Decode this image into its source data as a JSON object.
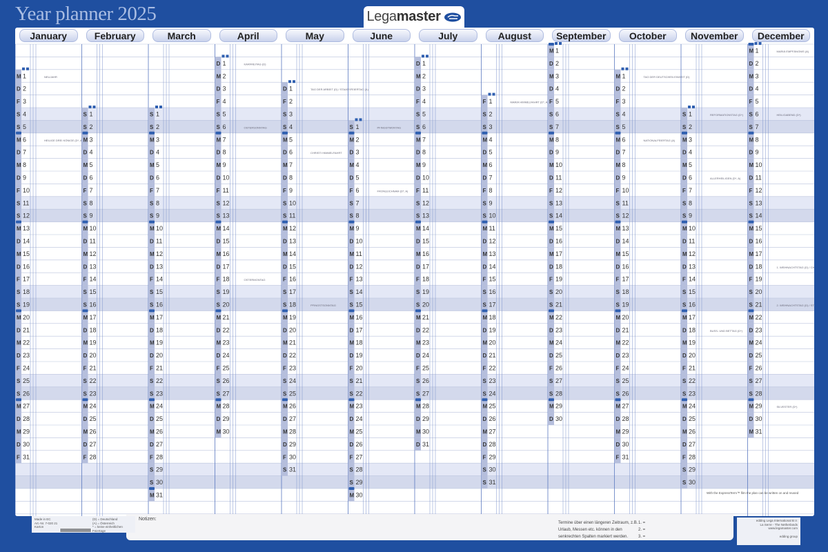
{
  "title": "Year planner 2025",
  "brand": {
    "prefix": "Lega",
    "bold": "master"
  },
  "months": [
    "January",
    "February",
    "March",
    "April",
    "May",
    "June",
    "July",
    "August",
    "September",
    "October",
    "November",
    "December"
  ],
  "weekday_letters": [
    "M",
    "D",
    "M",
    "D",
    "F",
    "S",
    "S"
  ],
  "footer": {
    "notes_label": "Notizen:",
    "termine_text": "Termine über einen längeren Zeitraum, z.B. Urlaub, Messen etc. können in den senkrechten Spalten markiert werden.",
    "numbered": [
      "1. =",
      "2. =",
      "3. ="
    ],
    "made_in": "Made in EC",
    "art_no": "Art.-Nr. 7-020 21",
    "karton": "Karton",
    "legend": [
      "(D) = Deutschland",
      "(A) = Österreich",
      "* = keine einheitlichen Feiertage"
    ],
    "company": "edding Lega International B.V.",
    "company_loc": "La Serre - The Netherlands",
    "company_web": "www.legamaster.com",
    "edding": "edding group",
    "tf_note": "With the ExpressTerm™ film the plan can be written on and reused"
  },
  "holiday_notes": [
    "NEUJAHR",
    "HEILIGE DREI KÖNIGE (D*, A)",
    "KARFREITAG (D)",
    "OSTERSONNTAG",
    "OSTERMONTAG",
    "TAG DER ARBEIT (D) / STAATSFEIERTAG (A)",
    "CHRISTI HIMMELFAHRT",
    "PFINGSTSONNTAG",
    "PFINGSTMONTAG",
    "FRONLEICHNAM (D*, A)",
    "MARIÄ HIMMELFAHRT (D*, A)",
    "TAG DER DEUTSCHEN EINHEIT (D)",
    "NATIONALFEIERTAG (A)",
    "REFORMATIONSTAG (D*)",
    "ALLERHEILIGEN (D*, A)",
    "BUSS- UND BETTAG (D*)",
    "MARIÄ EMPFÄNGNIS (A)",
    "HEILIGABEND (D*)",
    "1. WEIHNACHTSTAG (D) / CHRISTTAG (A)",
    "2. WEIHNACHTSTAG (D) / STEFANITAG (A)",
    "SILVESTER (D*)"
  ],
  "colors": {
    "frame": "#1f4fa0",
    "weekend_sat": "#e4e8f6",
    "weekend_sun": "#d3d9ec",
    "date_strip": "#b5bedc",
    "week_badge": "#2f5fb0"
  }
}
